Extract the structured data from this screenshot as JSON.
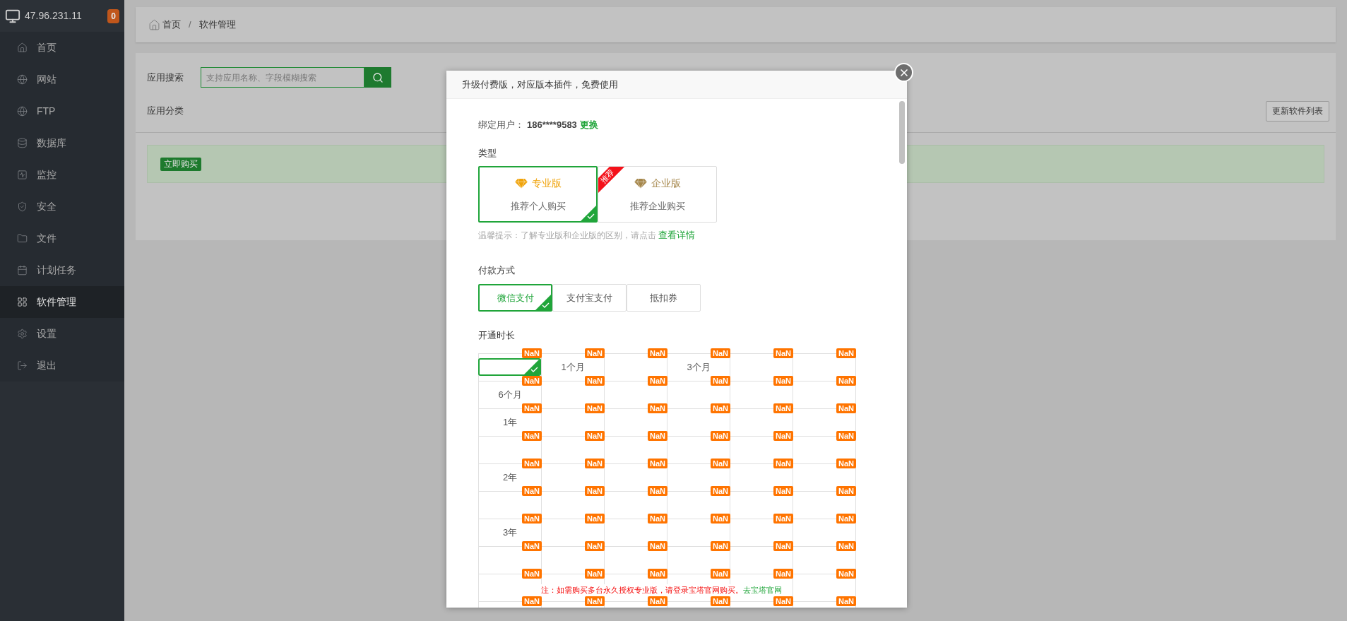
{
  "sidebar": {
    "host": "47.96.231.11",
    "badge": "0",
    "items": [
      {
        "label": "首页",
        "selected": false
      },
      {
        "label": "网站",
        "selected": false
      },
      {
        "label": "FTP",
        "selected": false
      },
      {
        "label": "数据库",
        "selected": false
      },
      {
        "label": "监控",
        "selected": false
      },
      {
        "label": "安全",
        "selected": false
      },
      {
        "label": "文件",
        "selected": false
      },
      {
        "label": "计划任务",
        "selected": false
      },
      {
        "label": "软件管理",
        "selected": true
      },
      {
        "label": "设置",
        "selected": false
      },
      {
        "label": "退出",
        "selected": false
      }
    ]
  },
  "breadcrumb": {
    "items": [
      "首页",
      "软件管理"
    ],
    "separator": "/"
  },
  "search": {
    "label": "应用搜索",
    "placeholder": "支持应用名称、字段模糊搜索"
  },
  "category": {
    "label": "应用分类"
  },
  "refresh_button": "更新软件列表",
  "buy_button": "立即购买",
  "modal": {
    "title": "升级付费版，对应版本插件，免费使用",
    "user_label": "绑定用户：",
    "user": "186****9583",
    "change_link": "更换",
    "type_label": "类型",
    "types": [
      {
        "name": "专业版",
        "desc": "推荐个人购买",
        "selected": true,
        "color": "#f0a30a"
      },
      {
        "name": "企业版",
        "desc": "推荐企业购买",
        "selected": false,
        "color": "#a5864a",
        "ribbon": "推荐"
      }
    ],
    "tip": "温馨提示：了解专业版和企业版的区别，请点击",
    "tip_link": "查看详情",
    "pay_label": "付款方式",
    "pay_methods": [
      {
        "label": "微信支付",
        "selected": true
      },
      {
        "label": "支付宝支付",
        "selected": false
      },
      {
        "label": "抵扣券",
        "selected": false
      }
    ],
    "duration_label": "开通时长",
    "durations": [
      [
        {
          "badge": "NaN",
          "selected": true
        },
        {
          "label": "1个月",
          "badge": "NaN",
          "selected": false
        },
        {
          "badge": "NaN",
          "selected": false
        },
        {
          "label": "3个月",
          "badge": "NaN",
          "selected": false
        },
        {
          "badge": "NaN",
          "selected": false
        },
        {
          "badge": "NaN",
          "selected": false
        }
      ],
      [
        {
          "label": "6个月",
          "badge": "NaN",
          "selected": false
        },
        {
          "badge": "NaN",
          "selected": false
        },
        {
          "badge": "NaN",
          "selected": false
        },
        {
          "badge": "NaN",
          "selected": false
        },
        {
          "badge": "NaN",
          "selected": false
        },
        {
          "badge": "NaN",
          "selected": false
        }
      ],
      [
        {
          "label": "1年",
          "badge": "NaN",
          "selected": false
        },
        {
          "badge": "NaN",
          "selected": false
        },
        {
          "badge": "NaN",
          "selected": false
        },
        {
          "badge": "NaN",
          "selected": false
        },
        {
          "badge": "NaN",
          "selected": false
        },
        {
          "badge": "NaN",
          "selected": false
        }
      ],
      [
        {
          "badge": "NaN",
          "selected": false
        },
        {
          "badge": "NaN",
          "selected": false
        },
        {
          "badge": "NaN",
          "selected": false
        },
        {
          "badge": "NaN",
          "selected": false
        },
        {
          "badge": "NaN",
          "selected": false
        },
        {
          "badge": "NaN",
          "selected": false
        }
      ],
      [
        {
          "label": "2年",
          "badge": "NaN",
          "selected": false
        },
        {
          "badge": "NaN",
          "selected": false
        },
        {
          "badge": "NaN",
          "selected": false
        },
        {
          "badge": "NaN",
          "selected": false
        },
        {
          "badge": "NaN",
          "selected": false
        },
        {
          "badge": "NaN",
          "selected": false
        }
      ],
      [
        {
          "badge": "NaN",
          "selected": false
        },
        {
          "badge": "NaN",
          "selected": false
        },
        {
          "badge": "NaN",
          "selected": false
        },
        {
          "badge": "NaN",
          "selected": false
        },
        {
          "badge": "NaN",
          "selected": false
        },
        {
          "badge": "NaN",
          "selected": false
        }
      ],
      [
        {
          "label": "3年",
          "badge": "NaN",
          "selected": false
        },
        {
          "badge": "NaN",
          "selected": false
        },
        {
          "badge": "NaN",
          "selected": false
        },
        {
          "badge": "NaN",
          "selected": false
        },
        {
          "badge": "NaN",
          "selected": false
        },
        {
          "badge": "NaN",
          "selected": false
        }
      ],
      [
        {
          "badge": "NaN",
          "selected": false
        },
        {
          "badge": "NaN",
          "selected": false
        },
        {
          "badge": "NaN",
          "selected": false
        },
        {
          "badge": "NaN",
          "selected": false
        },
        {
          "badge": "NaN",
          "selected": false
        },
        {
          "badge": "NaN",
          "selected": false
        }
      ],
      [
        {
          "badge": "NaN",
          "selected": false
        },
        {
          "badge": "NaN",
          "selected": false
        },
        {
          "badge": "NaN",
          "selected": false
        },
        {
          "badge": "NaN",
          "selected": false
        },
        {
          "badge": "NaN",
          "selected": false
        },
        {
          "badge": "NaN",
          "selected": false
        }
      ],
      [
        {
          "badge": "NaN",
          "selected": false
        },
        {
          "badge": "NaN",
          "selected": false
        },
        {
          "badge": "NaN",
          "selected": false
        },
        {
          "badge": "NaN",
          "selected": false
        },
        {
          "badge": "NaN",
          "selected": false
        },
        {
          "badge": "NaN",
          "selected": false
        }
      ]
    ],
    "note": "注：如需购买多台永久授权专业版，请登录宝塔官网购买。",
    "note_link": "去宝塔官网"
  }
}
